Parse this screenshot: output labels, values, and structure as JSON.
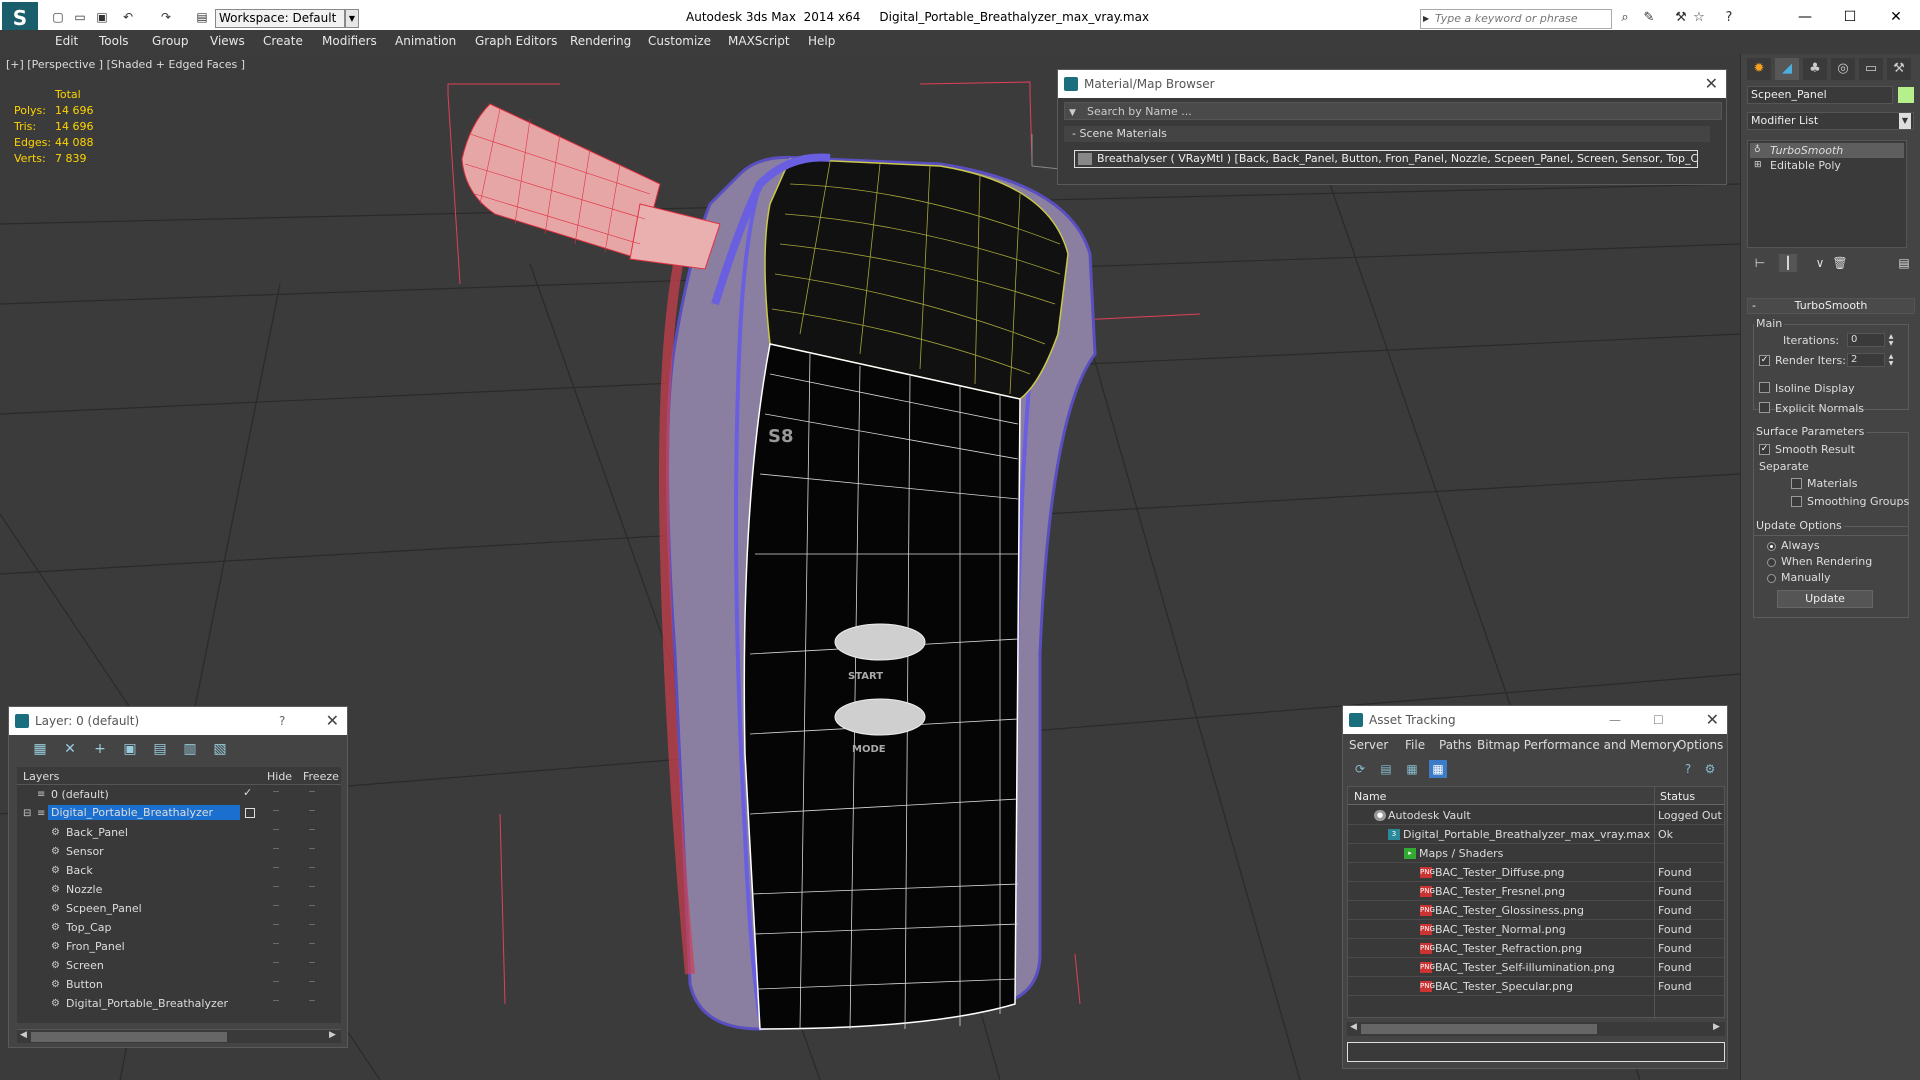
{
  "titlebar": {
    "workspace": "Workspace: Default",
    "app_title": "Autodesk 3ds Max  2014 x64     Digital_Portable_Breathalyzer_max_vray.max",
    "search_placeholder": "Type a keyword or phrase"
  },
  "menu": [
    "Edit",
    "Tools",
    "Group",
    "Views",
    "Create",
    "Modifiers",
    "Animation",
    "Graph Editors",
    "Rendering",
    "Customize",
    "MAXScript",
    "Help"
  ],
  "viewport": {
    "label": "[+] [Perspective ] [Shaded + Edged Faces ]",
    "stats": {
      "header": "Total",
      "rows": [
        {
          "k": "Polys:",
          "v": "14 696"
        },
        {
          "k": "Tris:",
          "v": "14 696"
        },
        {
          "k": "Edges:",
          "v": "44 088"
        },
        {
          "k": "Verts:",
          "v": "7 839"
        }
      ]
    },
    "model_text": {
      "top": "S8",
      "button1": "START",
      "button2": "MODE"
    }
  },
  "material_browser": {
    "title": "Material/Map Browser",
    "search": "Search by Name ...",
    "section": "- Scene Materials",
    "row": "Breathalyser  ( VRayMtl )  [Back, Back_Panel, Button, Fron_Panel, Nozzle, Scpeen_Panel, Screen, Sensor, Top_Cap]"
  },
  "layers": {
    "title": "Layer: 0 (default)",
    "help": "?",
    "cols": {
      "name": "Layers",
      "hide": "Hide",
      "freeze": "Freeze"
    },
    "rows": [
      {
        "name": "0 (default)",
        "indent": 0
      },
      {
        "name": "Digital_Portable_Breathalyzer",
        "indent": 0
      },
      {
        "name": "Back_Panel",
        "indent": 1
      },
      {
        "name": "Sensor",
        "indent": 1
      },
      {
        "name": "Back",
        "indent": 1
      },
      {
        "name": "Nozzle",
        "indent": 1
      },
      {
        "name": "Scpeen_Panel",
        "indent": 1
      },
      {
        "name": "Top_Cap",
        "indent": 1
      },
      {
        "name": "Fron_Panel",
        "indent": 1
      },
      {
        "name": "Screen",
        "indent": 1
      },
      {
        "name": "Button",
        "indent": 1
      },
      {
        "name": "Digital_Portable_Breathalyzer",
        "indent": 1
      }
    ]
  },
  "asset_tracking": {
    "title": "Asset Tracking",
    "menu": [
      "Server",
      "File",
      "Paths",
      "Bitmap Performance and Memory",
      "Options"
    ],
    "cols": {
      "name": "Name",
      "status": "Status"
    },
    "rows": [
      {
        "name": "Autodesk Vault",
        "status": "Logged Out",
        "indent": 1,
        "icon": "vault"
      },
      {
        "name": "Digital_Portable_Breathalyzer_max_vray.max",
        "status": "Ok",
        "indent": 2,
        "icon": "max"
      },
      {
        "name": "Maps / Shaders",
        "status": "",
        "indent": 3,
        "icon": "folder"
      },
      {
        "name": "BAC_Tester_Diffuse.png",
        "status": "Found",
        "indent": 4,
        "icon": "png"
      },
      {
        "name": "BAC_Tester_Fresnel.png",
        "status": "Found",
        "indent": 4,
        "icon": "png"
      },
      {
        "name": "BAC_Tester_Glossiness.png",
        "status": "Found",
        "indent": 4,
        "icon": "png"
      },
      {
        "name": "BAC_Tester_Normal.png",
        "status": "Found",
        "indent": 4,
        "icon": "png"
      },
      {
        "name": "BAC_Tester_Refraction.png",
        "status": "Found",
        "indent": 4,
        "icon": "png"
      },
      {
        "name": "BAC_Tester_Self-illumination.png",
        "status": "Found",
        "indent": 4,
        "icon": "png"
      },
      {
        "name": "BAC_Tester_Specular.png",
        "status": "Found",
        "indent": 4,
        "icon": "png"
      }
    ]
  },
  "command_panel": {
    "object_name": "Scpeen_Panel",
    "object_color": "#b6f08a",
    "modifier_list": "Modifier List",
    "stack": [
      "TurboSmooth",
      "Editable Poly"
    ],
    "rollout": "TurboSmooth",
    "main": "Main",
    "iterations_label": "Iterations:",
    "iterations_value": "0",
    "render_iters_label": "Render Iters:",
    "render_iters_value": "2",
    "isoline": "Isoline Display",
    "explicit": "Explicit Normals",
    "surface_params": "Surface Parameters",
    "smooth_result": "Smooth Result",
    "separate": "Separate",
    "materials": "Materials",
    "smoothing_groups": "Smoothing Groups",
    "update_options": "Update Options",
    "always": "Always",
    "when_rendering": "When Rendering",
    "manually": "Manually",
    "update": "Update"
  }
}
